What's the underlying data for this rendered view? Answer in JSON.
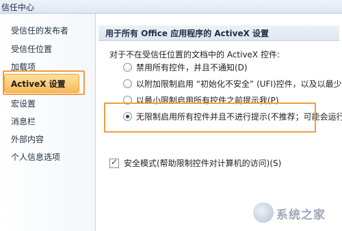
{
  "window": {
    "title": "信任中心"
  },
  "sidebar": {
    "items": [
      {
        "label": "受信任的发布者"
      },
      {
        "label": "受信任位置"
      },
      {
        "label": "加载项"
      },
      {
        "label": "ActiveX 设置",
        "active": true
      },
      {
        "label": "宏设置"
      },
      {
        "label": "消息栏"
      },
      {
        "label": "外部内容"
      },
      {
        "label": "个人信息选项"
      }
    ]
  },
  "main": {
    "section_title": "用于所有 Office 应用程序的 ActiveX 设置",
    "description": "对于不在受信任位置的文档中的 ActiveX 控件:",
    "options": [
      {
        "label": "禁用所有控件，并且不通知(D)",
        "checked": false
      },
      {
        "label": "以附加限制启用 “初始化不安全” (UFI)控件，以及以最少",
        "checked": false
      },
      {
        "label": "以最小限制启用所有控件之前提示我(P)",
        "checked": false
      },
      {
        "label": "无限制启用所有控件并且不进行提示(不推荐；可能会运行",
        "checked": true
      }
    ],
    "safe_mode": {
      "label": "安全模式(帮助限制控件对计算机的访问)(S)",
      "checked": true
    }
  },
  "colors": {
    "highlight_border": "#f29a3e",
    "active_item": "#f7b95a"
  },
  "watermark": {
    "text": "系统之家"
  }
}
